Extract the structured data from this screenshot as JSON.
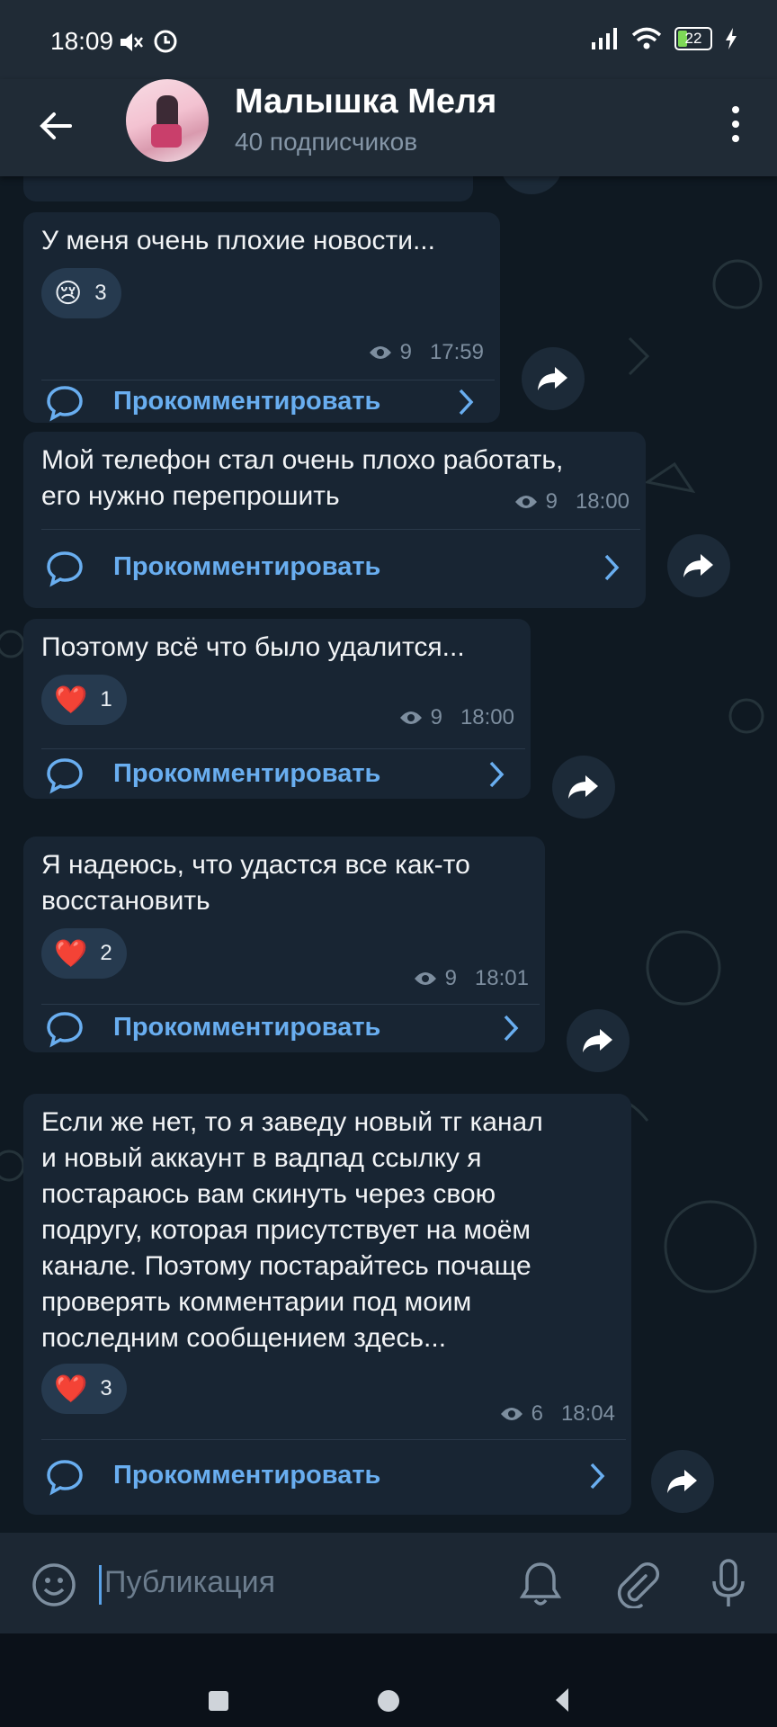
{
  "status_bar": {
    "time": "18:09",
    "battery": "22"
  },
  "header": {
    "title": "Малышка Меля",
    "subtitle": "40 подписчиков"
  },
  "comment_label": "Прокомментировать",
  "messages": [
    {
      "text": "У меня очень плохие новости...",
      "reaction": {
        "emoji": "😢",
        "count": "3"
      },
      "views": "9",
      "time": "17:59"
    },
    {
      "text": "Мой телефон стал очень плохо работать,\nего нужно перепрошить",
      "views": "9",
      "time": "18:00"
    },
    {
      "text": "Поэтому всё что было удалится...",
      "reaction": {
        "emoji": "❤️",
        "count": "1"
      },
      "views": "9",
      "time": "18:00"
    },
    {
      "text": "Я надеюсь, что удастся все как-то\nвосстановить",
      "reaction": {
        "emoji": "❤️",
        "count": "2"
      },
      "views": "9",
      "time": "18:01"
    },
    {
      "text": "Если же нет, то я заведу новый тг канал\nи новый аккаунт в вадпад ссылку я\nпостараюсь вам скинуть через свою\nподругу, которая присутствует на моём\nканале. Поэтому постарайтесь почаще\nпроверять комментарии под моим\nпоследним сообщением здесь...",
      "reaction": {
        "emoji": "❤️",
        "count": "3"
      },
      "views": "6",
      "time": "18:04"
    }
  ],
  "input": {
    "placeholder": "Публикация"
  },
  "colors": {
    "accent": "#69aef0",
    "bubble": "#182533",
    "background": "#0e1621",
    "header": "#202b36"
  }
}
